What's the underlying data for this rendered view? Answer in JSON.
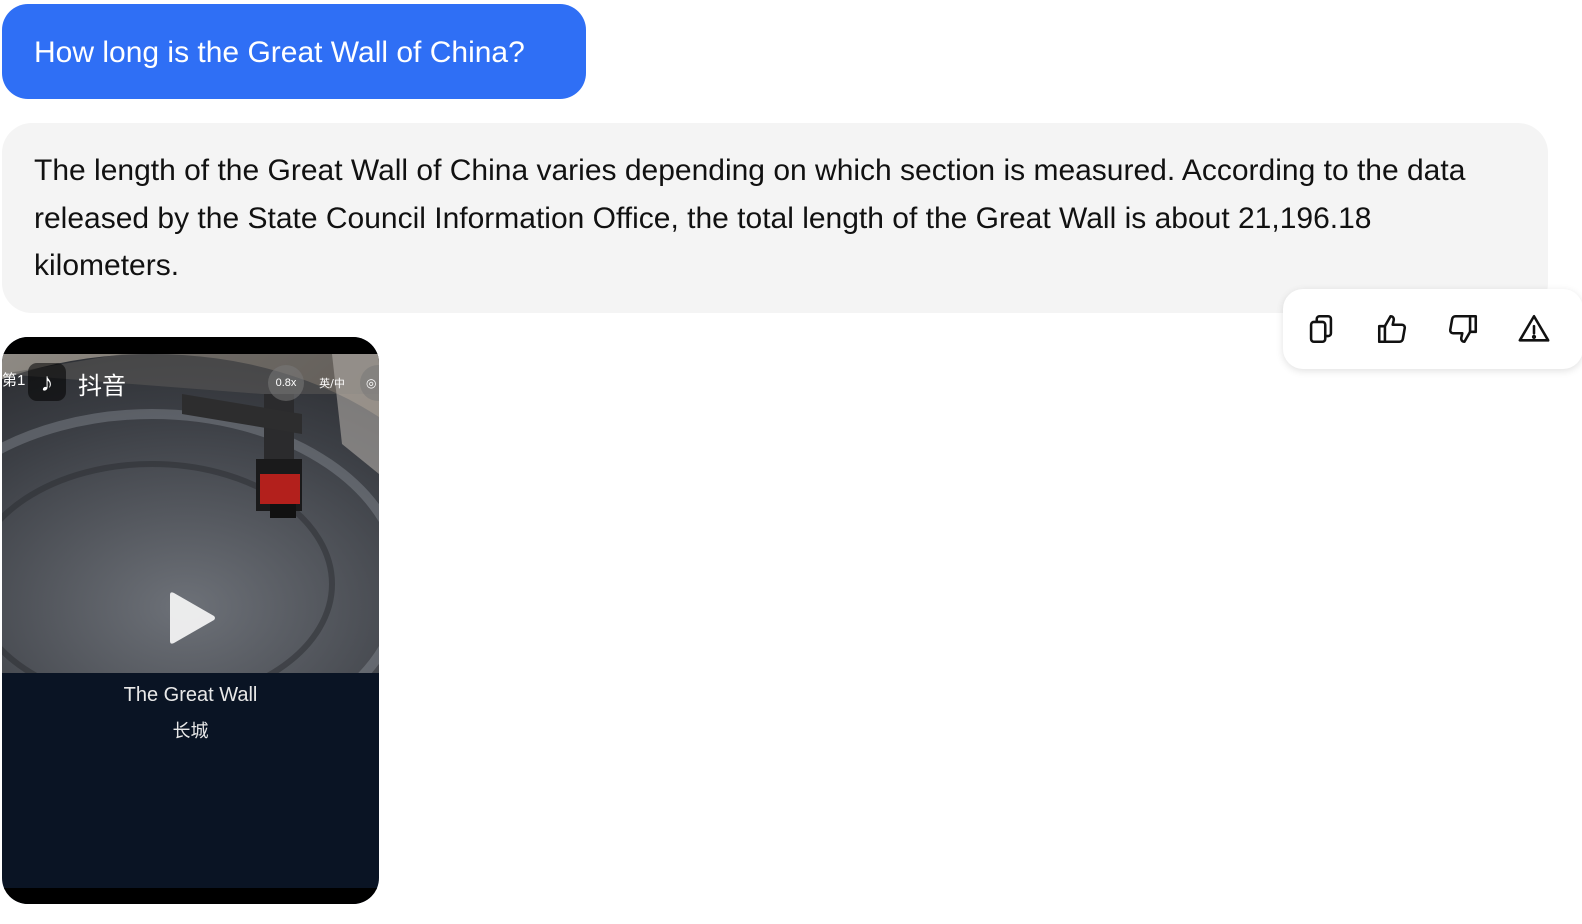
{
  "conversation": {
    "user_message": "How long is the Great Wall of China?",
    "assistant_message": "The length of the Great Wall of China varies depending on which section is measured. According to the data released by the State Council Information Office, the total length of the Great Wall is about 21,196.18 kilometers."
  },
  "actions": {
    "items": [
      {
        "name": "copy-icon"
      },
      {
        "name": "thumbs-up-icon"
      },
      {
        "name": "thumbs-down-icon"
      },
      {
        "name": "report-warning-icon"
      }
    ]
  },
  "video": {
    "episode_label": "第1",
    "app_logo_icon": "tiktok-icon",
    "app_name": "抖音",
    "speed_label": "0.8x",
    "subtitle_lang_label": "英/中",
    "caption_en": "The Great Wall",
    "caption_zh": "长城"
  },
  "colors": {
    "user_bubble": "#2f6ff5",
    "assistant_bubble": "#f4f4f4",
    "video_caption_bg": "#0a1424"
  }
}
